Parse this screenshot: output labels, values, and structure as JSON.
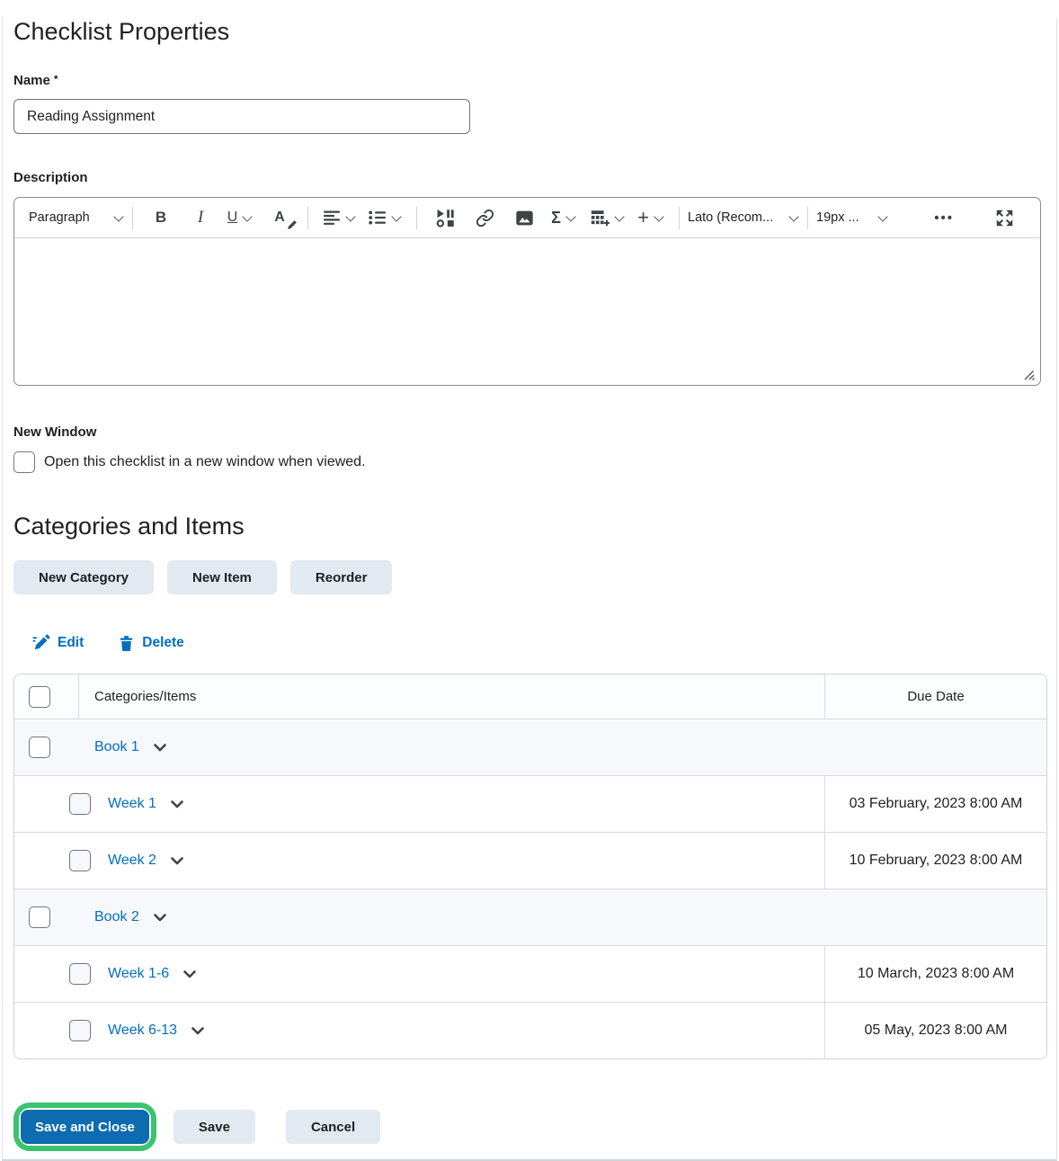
{
  "title": "Checklist Properties",
  "name": {
    "label": "Name",
    "required": "*",
    "value": "Reading Assignment"
  },
  "description": {
    "label": "Description"
  },
  "toolbar": {
    "paragraph": "Paragraph",
    "bold": "B",
    "italic": "I",
    "underline": "U",
    "color_letter": "A",
    "sigma": "Σ",
    "plus": "+",
    "font": "Lato (Recom...",
    "size": "19px ...",
    "more": "•••"
  },
  "new_window": {
    "label": "New Window",
    "option": "Open this checklist in a new window when viewed."
  },
  "categories": {
    "heading": "Categories and Items",
    "new_category": "New Category",
    "new_item": "New Item",
    "reorder": "Reorder",
    "edit": "Edit",
    "delete": "Delete"
  },
  "table": {
    "header_items": "Categories/Items",
    "header_due": "Due Date",
    "rows": [
      {
        "type": "category",
        "label": "Book 1",
        "due": ""
      },
      {
        "type": "item",
        "label": "Week 1",
        "due": "03 February, 2023 8:00 AM"
      },
      {
        "type": "item",
        "label": "Week 2",
        "due": "10 February, 2023 8:00 AM"
      },
      {
        "type": "category",
        "label": "Book 2",
        "due": ""
      },
      {
        "type": "item",
        "label": "Week 1-6",
        "due": "10 March, 2023 8:00 AM"
      },
      {
        "type": "item",
        "label": "Week 6-13",
        "due": "05 May, 2023 8:00 AM"
      }
    ]
  },
  "footer": {
    "save_and_close": "Save and Close",
    "save": "Save",
    "cancel": "Cancel"
  },
  "colors": {
    "link": "#006fbf",
    "primary": "#0d6cb0",
    "highlight": "#3cc36f"
  }
}
